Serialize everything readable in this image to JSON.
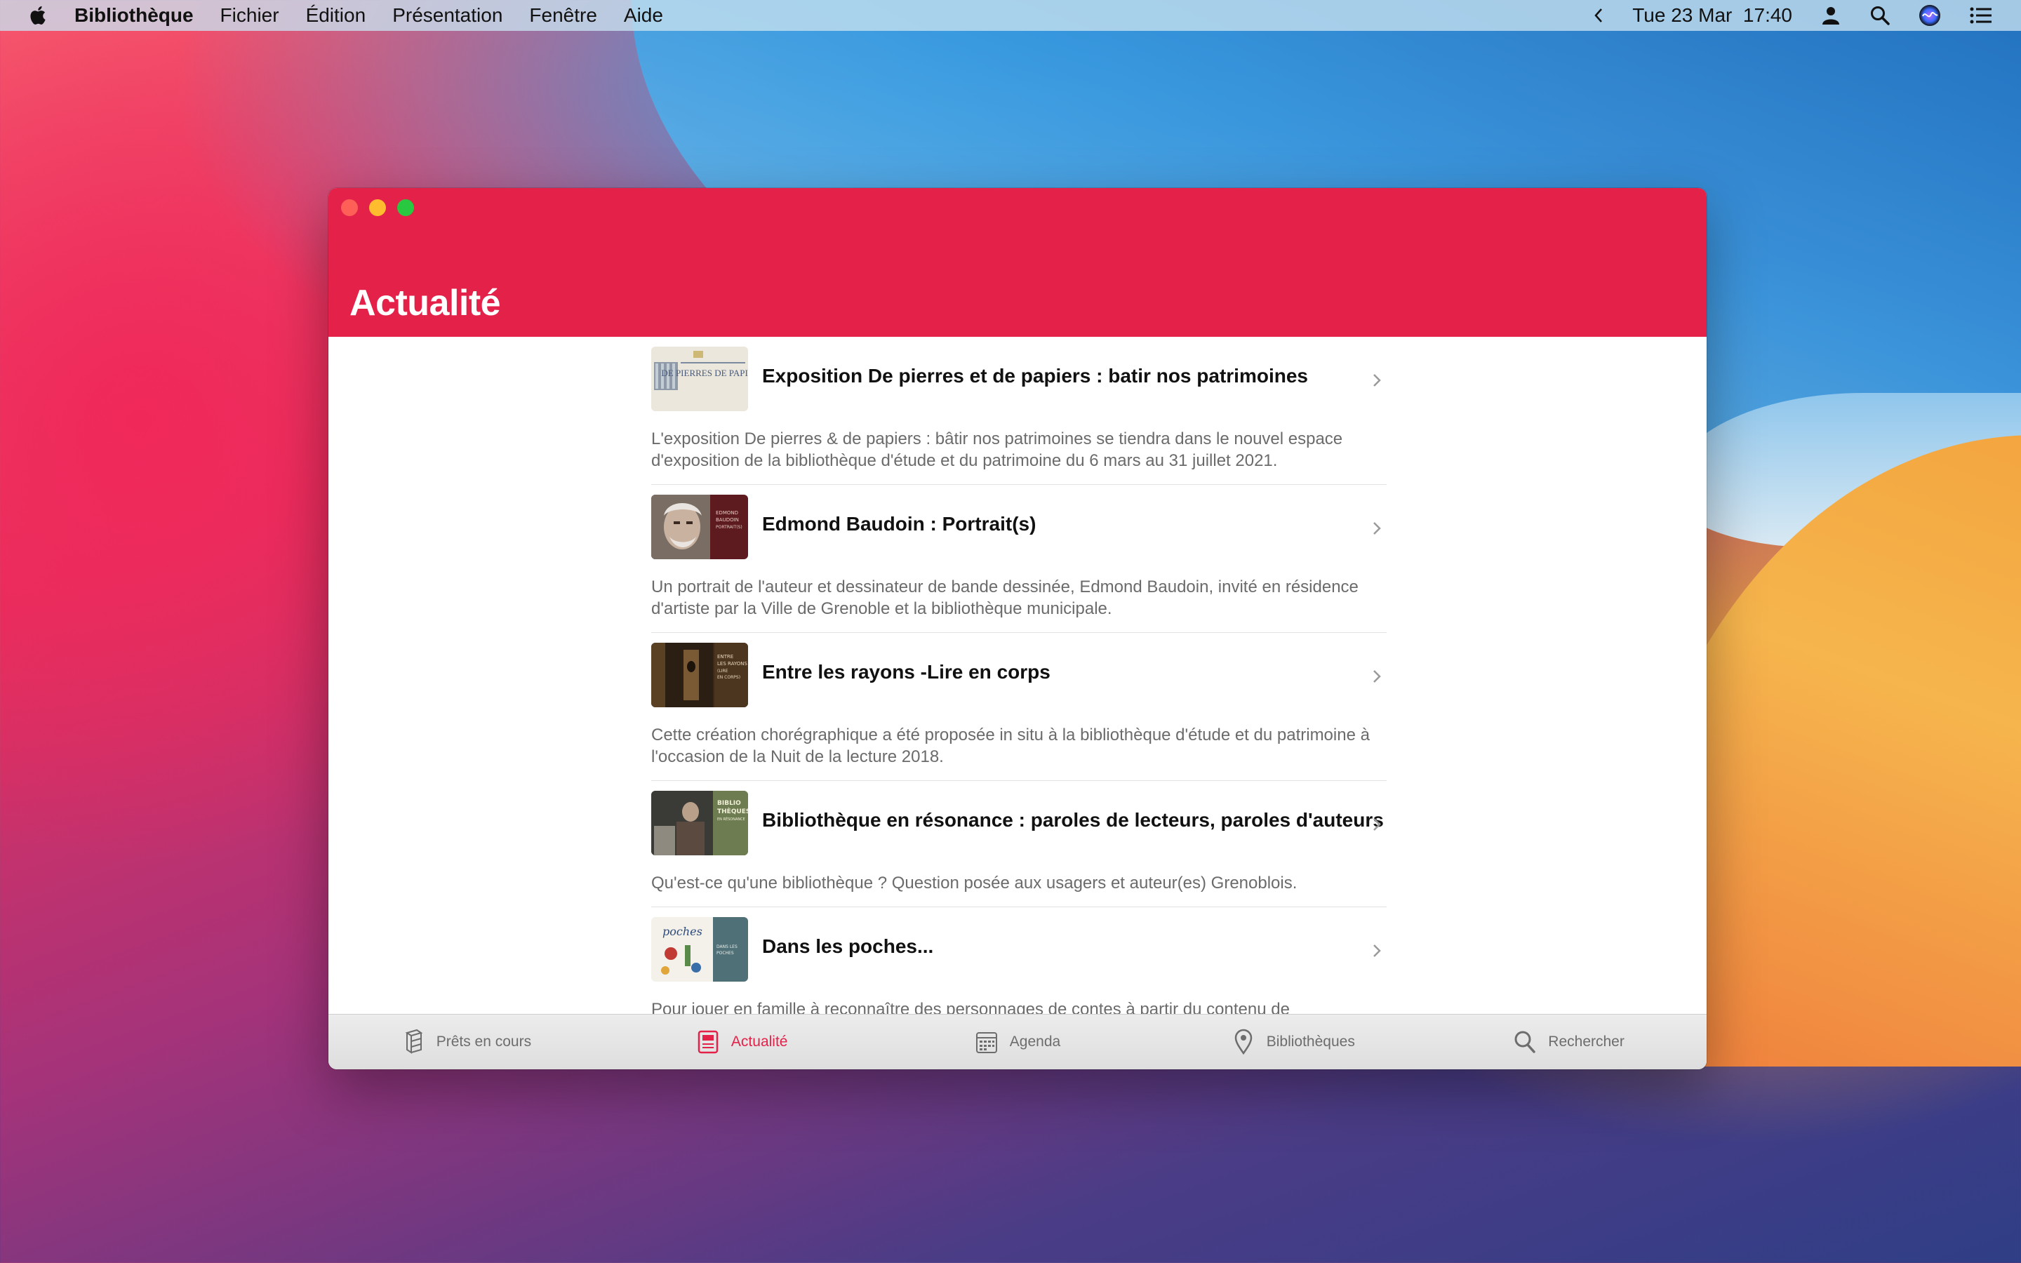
{
  "menubar": {
    "app_name": "Bibliothèque",
    "menus": [
      "Fichier",
      "Édition",
      "Présentation",
      "Fenêtre",
      "Aide"
    ],
    "clock": "Tue 23 Mar  17:40"
  },
  "window": {
    "title": "Actualité",
    "accent_color": "#e42149"
  },
  "news": [
    {
      "title": "Exposition De pierres et de papiers : batir nos patrimoines",
      "description": "L'exposition De pierres & de papiers : bâtir nos patrimoines se tiendra dans le nouvel espace d'exposition de la bibliothèque d'étude et du patrimoine du 6 mars au 31 juillet 2021.",
      "thumb_text": "DE PIERRES DE PAPIERS"
    },
    {
      "title": "Edmond Baudoin : Portrait(s)",
      "description": "Un portrait de l'auteur et dessinateur de bande dessinée, Edmond Baudoin, invité en résidence d'artiste par la Ville de Grenoble et la bibliothèque municipale.",
      "thumb_text": "EDMOND BAUDOIN PORTRAIT(S)"
    },
    {
      "title": "Entre les rayons -Lire en corps",
      "description": "Cette création chorégraphique a été proposée in situ à la bibliothèque d'étude et du patrimoine à l'occasion de la Nuit de la lecture 2018.",
      "thumb_text": "ENTRE LES RAYONS LIRE EN CORPS"
    },
    {
      "title": "Bibliothèque en résonance : paroles de lecteurs, paroles d'auteurs",
      "description": "Qu'est-ce qu'une bibliothèque ? Question posée aux usagers et auteur(es) Grenoblois.",
      "thumb_text": "BIBLIO THÈQUES"
    },
    {
      "title": "Dans les poches...",
      "description": "Pour jouer en famille à reconnaître des personnages de contes à partir du contenu de leurs poches.",
      "thumb_text": "DANS LES POCHES"
    }
  ],
  "tabbar": [
    {
      "label": "Prêts en cours",
      "icon": "books-stack-icon",
      "active": false
    },
    {
      "label": "Actualité",
      "icon": "newspaper-icon",
      "active": true
    },
    {
      "label": "Agenda",
      "icon": "calendar-icon",
      "active": false
    },
    {
      "label": "Bibliothèques",
      "icon": "map-pin-icon",
      "active": false
    },
    {
      "label": "Rechercher",
      "icon": "search-icon",
      "active": false
    }
  ]
}
